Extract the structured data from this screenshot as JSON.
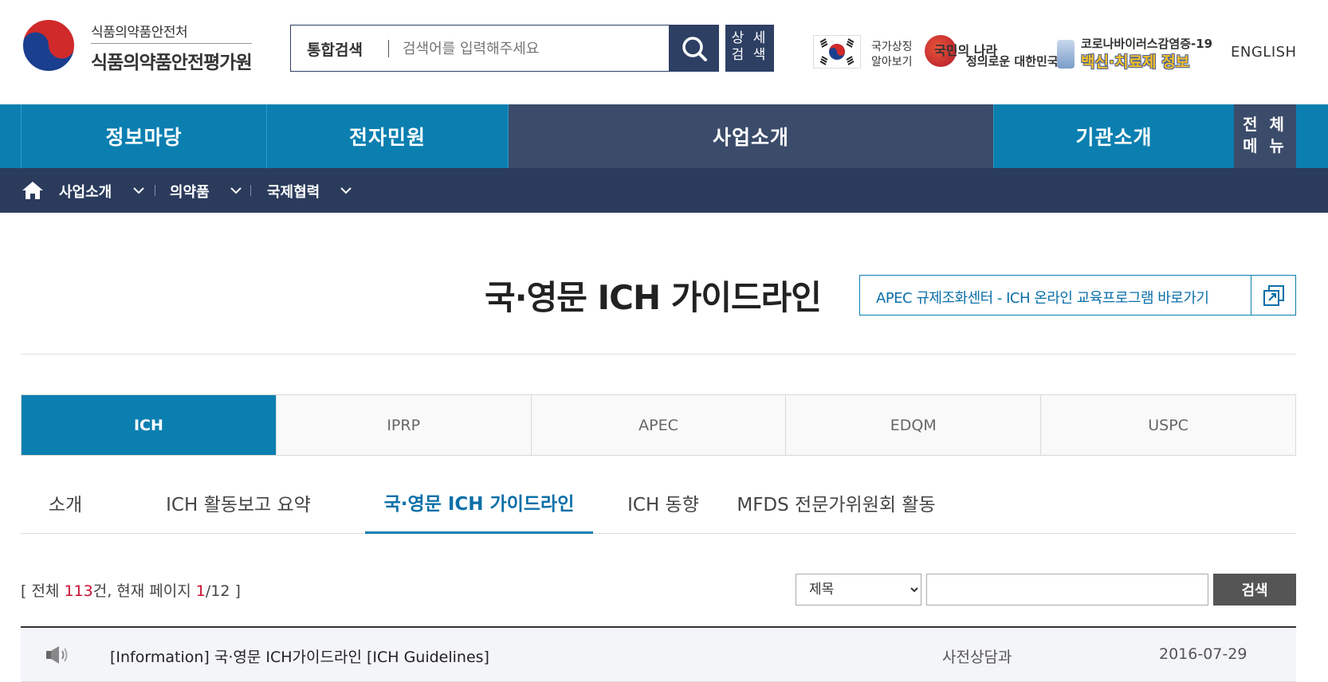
{
  "header": {
    "org_small": "식품의약품안전처",
    "org_big": "식품의약품안전평가원",
    "search_label": "통합검색",
    "search_placeholder": "검색어를 입력해주세요",
    "detail_search": "상세\n검색",
    "detail_line1": "상 세",
    "detail_line2": "검 색",
    "symbol_line1": "국가상징",
    "symbol_line2": "알아보기",
    "slogan_line1": "국민의 나라",
    "slogan_line2": "정의로운 대한민국",
    "covid_line1": "코로나바이러스감염증-19",
    "covid_line2": "백신·치료제 정보",
    "english": "ENGLISH"
  },
  "gnb": {
    "items": [
      "정보마당",
      "전자민원",
      "사업소개",
      "기관소개"
    ],
    "all_menu_line1": "전 체",
    "all_menu_line2": "메 뉴"
  },
  "breadcrumb": [
    "사업소개",
    "의약품",
    "국제협력"
  ],
  "page": {
    "title": "국·영문 ICH 가이드라인",
    "apec_link": "APEC 규제조화센터 - ICH 온라인 교육프로그램 바로가기"
  },
  "org_tabs": [
    "ICH",
    "IPRP",
    "APEC",
    "EDQM",
    "USPC"
  ],
  "sub_tabs": [
    "소개",
    "ICH 활동보고 요약",
    "국·영문 ICH 가이드라인",
    "ICH 동향",
    "MFDS 전문가위원회 활동"
  ],
  "list": {
    "count_prefix": "[ 전체 ",
    "total": "113",
    "count_mid": "건, 현재 페이지 ",
    "current_page": "1",
    "count_suffix": "/12 ]",
    "filter_selected": "제목",
    "search_button": "검색"
  },
  "rows": [
    {
      "title": "[Information] 국·영문 ICH가이드라인 [ICH Guidelines]",
      "dept": "사전상담과",
      "date": "2016-07-29"
    }
  ],
  "colors": {
    "primary_blue": "#0b7fb0",
    "navy": "#2b3b5c",
    "active_nav": "#3b4b6a",
    "highlight_red": "#c8102e"
  }
}
